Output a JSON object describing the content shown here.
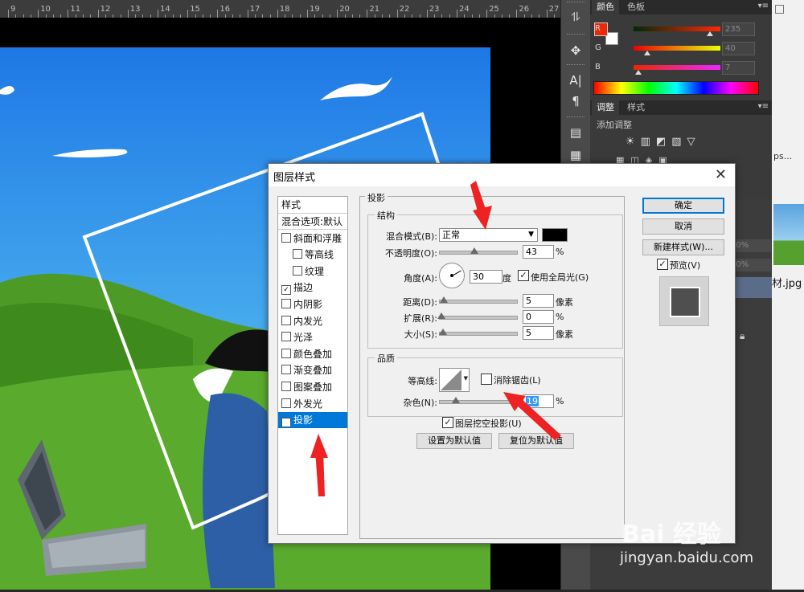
{
  "ruler": {
    "labels": [
      "9",
      "10",
      "11",
      "12",
      "13",
      "14",
      "15",
      "16",
      "17",
      "18",
      "19",
      "20",
      "21",
      "22",
      "23",
      "24",
      "25",
      "26",
      "27"
    ]
  },
  "color_panel": {
    "tabs": [
      "颜色",
      "色板"
    ],
    "channels": [
      {
        "name": "R",
        "value": "235"
      },
      {
        "name": "G",
        "value": "40"
      },
      {
        "name": "B",
        "value": "7"
      }
    ],
    "foreground_color": "#eb2807"
  },
  "adjust_panel": {
    "tabs": [
      "调整",
      "样式"
    ],
    "title": "添加调整"
  },
  "side_panel_text": {
    "zoom_a": "00%",
    "zoom_b": "00%",
    "tab_text": "ps...",
    "file_label": "材.jpg"
  },
  "dialog": {
    "title": "图层样式",
    "close": "✕",
    "style_list": {
      "header": "样式",
      "items": [
        {
          "label": "混合选项:默认",
          "checkbox": false,
          "checked": false,
          "indent": false,
          "selected": false
        },
        {
          "label": "斜面和浮雕",
          "checkbox": true,
          "checked": false,
          "indent": false,
          "selected": false
        },
        {
          "label": "等高线",
          "checkbox": true,
          "checked": false,
          "indent": true,
          "selected": false
        },
        {
          "label": "纹理",
          "checkbox": true,
          "checked": false,
          "indent": true,
          "selected": false
        },
        {
          "label": "描边",
          "checkbox": true,
          "checked": true,
          "indent": false,
          "selected": false
        },
        {
          "label": "内阴影",
          "checkbox": true,
          "checked": false,
          "indent": false,
          "selected": false
        },
        {
          "label": "内发光",
          "checkbox": true,
          "checked": false,
          "indent": false,
          "selected": false
        },
        {
          "label": "光泽",
          "checkbox": true,
          "checked": false,
          "indent": false,
          "selected": false
        },
        {
          "label": "颜色叠加",
          "checkbox": true,
          "checked": false,
          "indent": false,
          "selected": false
        },
        {
          "label": "渐变叠加",
          "checkbox": true,
          "checked": false,
          "indent": false,
          "selected": false
        },
        {
          "label": "图案叠加",
          "checkbox": true,
          "checked": false,
          "indent": false,
          "selected": false
        },
        {
          "label": "外发光",
          "checkbox": true,
          "checked": false,
          "indent": false,
          "selected": false
        },
        {
          "label": "投影",
          "checkbox": true,
          "checked": true,
          "indent": false,
          "selected": true
        }
      ]
    },
    "section_title": "投影",
    "structure": {
      "title": "结构",
      "blend_mode_label": "混合模式(B):",
      "blend_mode_value": "正常",
      "shadow_color": "#000000",
      "opacity_label": "不透明度(O):",
      "opacity_value": "43",
      "percent": "%",
      "angle_label": "角度(A):",
      "angle_value": "30",
      "degree": "度",
      "global_light_label": "使用全局光(G)",
      "global_light_checked": true,
      "distance_label": "距离(D):",
      "distance_value": "5",
      "spread_label": "扩展(R):",
      "spread_value": "0",
      "size_label": "大小(S):",
      "size_value": "5",
      "pixels": "像素"
    },
    "quality": {
      "title": "品质",
      "contour_label": "等高线:",
      "antialias_label": "消除锯齿(L)",
      "antialias_checked": false,
      "noise_label": "杂色(N):",
      "noise_value": "19",
      "percent": "%"
    },
    "knockout_label": "图层挖空投影(U)",
    "knockout_checked": true,
    "set_default_button": "设置为默认值",
    "reset_default_button": "复位为默认值",
    "ok_button": "确定",
    "cancel_button": "取消",
    "new_style_button": "新建样式(W)...",
    "preview_label": "预览(V)",
    "preview_checked": true
  },
  "watermark": {
    "brand": "Bai 经验",
    "url": "jingyan.baidu.com"
  }
}
